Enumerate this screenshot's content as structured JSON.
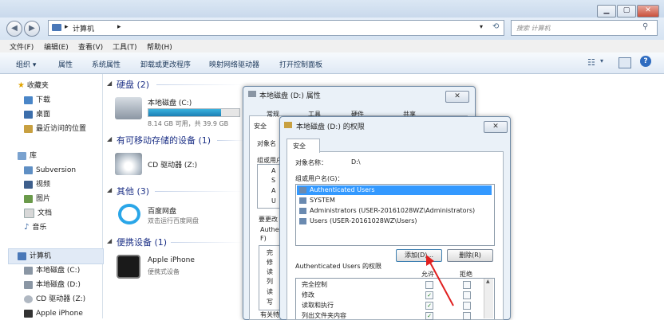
{
  "window": {
    "minimize": "▁",
    "maximize": "▢",
    "close": "✕"
  },
  "address": {
    "path": "计算机",
    "search_placeholder": "搜索 计算机"
  },
  "menu": [
    "文件(F)",
    "编辑(E)",
    "查看(V)",
    "工具(T)",
    "帮助(H)"
  ],
  "toolbar": [
    "组织 ▾",
    "属性",
    "系统属性",
    "卸载或更改程序",
    "映射网络驱动器",
    "打开控制面板"
  ],
  "nav": {
    "favorites": "收藏夹",
    "fav_items": [
      "下载",
      "桌面",
      "最近访问的位置"
    ],
    "libraries": "库",
    "lib_items": [
      "Subversion",
      "视频",
      "图片",
      "文档",
      "音乐"
    ],
    "computer": "计算机",
    "comp_items": [
      "本地磁盘 (C:)",
      "本地磁盘 (D:)",
      "CD 驱动器 (Z:)",
      "Apple iPhone"
    ]
  },
  "groups": {
    "hdd": "硬盘 (2)",
    "removable": "有可移动存储的设备 (1)",
    "other": "其他 (3)",
    "portable": "便携设备 (1)"
  },
  "items": {
    "c_name": "本地磁盘 (C:)",
    "c_free": "8.14 GB 可用，共 39.9 GB",
    "c_usage": 0.8,
    "cd_name": "CD 驱动器 (Z:)",
    "baidu_name": "百度网盘",
    "baidu_sub": "双击运行百度网盘",
    "iphone_name": "Apple iPhone",
    "iphone_sub": "便携式设备"
  },
  "props": {
    "title": "本地磁盘 (D:) 属性",
    "tabs": [
      "常规",
      "工具",
      "硬件",
      "共享"
    ],
    "tab_partial": "安全",
    "obj_partial": "对象名",
    "group_partial": "组或用户",
    "list_partial": [
      "A",
      "S",
      "A",
      "U"
    ],
    "change_partial": "要更改",
    "perm_partial": [
      "Authe",
      "F)"
    ],
    "perm_rows_partial": [
      "完",
      "修",
      "读",
      "列",
      "读",
      "写"
    ],
    "footer_partial": "有关特"
  },
  "perms": {
    "title": "本地磁盘 (D:) 的权限",
    "tab": "安全",
    "object_label": "对象名称：",
    "object_value": "D:\\",
    "group_label": "组或用户名(G)：",
    "users": [
      "Authenticated Users",
      "SYSTEM",
      "Administrators (USER-20161028WZ\\Administrators)",
      "Users (USER-20161028WZ\\Users)"
    ],
    "add_button": "添加(D)...",
    "remove_button": "删除(R)",
    "perm_label": "Authenticated Users 的权限",
    "allow": "允许",
    "deny": "拒绝",
    "rows": [
      "完全控制",
      "修改",
      "读取和执行",
      "列出文件夹内容"
    ],
    "allow_checked": [
      false,
      true,
      true,
      true
    ]
  }
}
